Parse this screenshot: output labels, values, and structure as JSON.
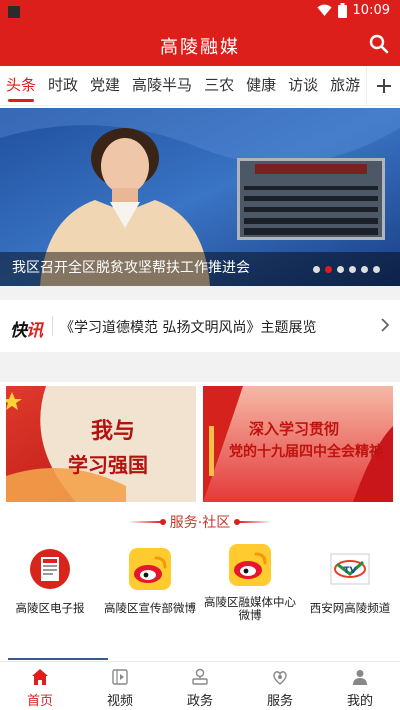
{
  "status_bar": {
    "time": "10:09"
  },
  "header": {
    "title": "高陵融媒"
  },
  "tabs": [
    {
      "label": "头条",
      "active": true
    },
    {
      "label": "时政"
    },
    {
      "label": "党建"
    },
    {
      "label": "高陵半马"
    },
    {
      "label": "三农"
    },
    {
      "label": "健康"
    },
    {
      "label": "访谈"
    },
    {
      "label": "旅游"
    }
  ],
  "banner": {
    "caption": "我区召开全区脱贫攻坚帮扶工作推进会",
    "dot_count": 6,
    "active_dot": 1
  },
  "news_flash": {
    "logo_black": "快",
    "logo_red": "讯",
    "text": "《学习道德模范  弘扬文明风尚》主题展览"
  },
  "promos": [
    {
      "lettering": "我与学习强国"
    },
    {
      "lettering": "深入学习贯彻党的十九届四中全会精神"
    }
  ],
  "services": {
    "title": "服务·社区",
    "items": [
      {
        "label": "高陵区电子报",
        "icon": "newspaper-icon"
      },
      {
        "label": "高陵区宣传部微博",
        "icon": "weibo-icon"
      },
      {
        "label": "高陵区融媒体中心微博",
        "icon": "weibo-icon"
      },
      {
        "label": "西安网高陵频道",
        "icon": "tv-channel-icon"
      }
    ]
  },
  "bottom_nav": [
    {
      "label": "首页",
      "icon": "home-icon",
      "active": true
    },
    {
      "label": "视频",
      "icon": "video-icon"
    },
    {
      "label": "政务",
      "icon": "government-icon"
    },
    {
      "label": "服务",
      "icon": "service-icon"
    },
    {
      "label": "我的",
      "icon": "profile-icon"
    }
  ],
  "colors": {
    "brand_red": "#dc1f1b",
    "indicator_blue": "#3a5c8a"
  }
}
